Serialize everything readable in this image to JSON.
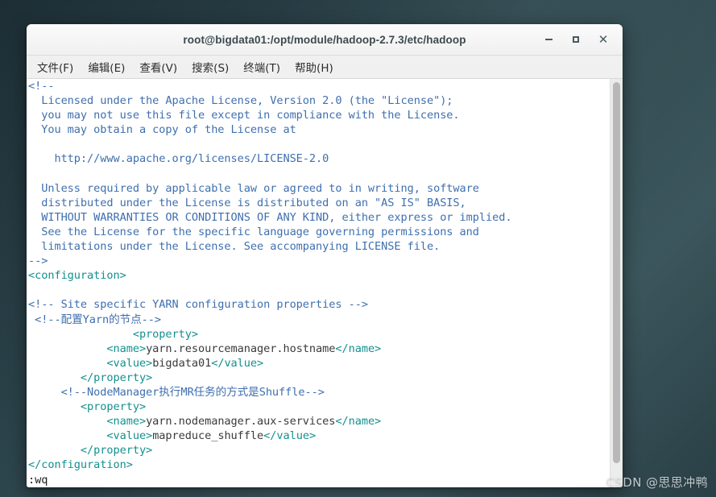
{
  "window": {
    "title": "root@bigdata01:/opt/module/hadoop-2.7.3/etc/hadoop",
    "buttons": {
      "minimize": "–",
      "maximize": "□",
      "close": "✕"
    }
  },
  "menubar": {
    "items": [
      {
        "label": "文件(F)"
      },
      {
        "label": "编辑(E)"
      },
      {
        "label": "查看(V)"
      },
      {
        "label": "搜索(S)"
      },
      {
        "label": "终端(T)"
      },
      {
        "label": "帮助(H)"
      }
    ]
  },
  "terminal": {
    "lines": [
      {
        "id": 1,
        "text": "<!--",
        "color_role": "comment"
      },
      {
        "id": 2,
        "text": "  Licensed under the Apache License, Version 2.0 (the \"License\");",
        "color_role": "comment"
      },
      {
        "id": 3,
        "text": "  you may not use this file except in compliance with the License.",
        "color_role": "comment"
      },
      {
        "id": 4,
        "text": "  You may obtain a copy of the License at",
        "color_role": "comment"
      },
      {
        "id": 5,
        "text": "",
        "color_role": "comment"
      },
      {
        "id": 6,
        "text": "    http://www.apache.org/licenses/LICENSE-2.0",
        "color_role": "comment"
      },
      {
        "id": 7,
        "text": "",
        "color_role": "comment"
      },
      {
        "id": 8,
        "text": "  Unless required by applicable law or agreed to in writing, software",
        "color_role": "comment"
      },
      {
        "id": 9,
        "text": "  distributed under the License is distributed on an \"AS IS\" BASIS,",
        "color_role": "comment"
      },
      {
        "id": 10,
        "text": "  WITHOUT WARRANTIES OR CONDITIONS OF ANY KIND, either express or implied.",
        "color_role": "comment"
      },
      {
        "id": 11,
        "text": "  See the License for the specific language governing permissions and",
        "color_role": "comment"
      },
      {
        "id": 12,
        "text": "  limitations under the License. See accompanying LICENSE file.",
        "color_role": "comment"
      },
      {
        "id": 13,
        "text": "-->",
        "color_role": "comment"
      },
      {
        "id": 14,
        "text": "<configuration>",
        "color_role": "tag"
      },
      {
        "id": 15,
        "text": "",
        "color_role": "plain"
      },
      {
        "id": 16,
        "text": "<!-- Site specific YARN configuration properties -->",
        "color_role": "comment"
      },
      {
        "id": 17,
        "text": " <!--配置Yarn的节点-->",
        "color_role": "comment"
      },
      {
        "id": 18,
        "text": "                <property>",
        "color_role": "tag"
      },
      {
        "id": 19,
        "text": "            <name>yarn.resourcemanager.hostname</name>",
        "color_role": "mixed",
        "segments": [
          {
            "t": "            ",
            "c": "plain"
          },
          {
            "t": "<name>",
            "c": "tag"
          },
          {
            "t": "yarn.resourcemanager.hostname",
            "c": "plain"
          },
          {
            "t": "</name>",
            "c": "tag"
          }
        ]
      },
      {
        "id": 20,
        "text": "            <value>bigdata01</value>",
        "color_role": "mixed",
        "segments": [
          {
            "t": "            ",
            "c": "plain"
          },
          {
            "t": "<value>",
            "c": "tag"
          },
          {
            "t": "bigdata01",
            "c": "plain"
          },
          {
            "t": "</value>",
            "c": "tag"
          }
        ]
      },
      {
        "id": 21,
        "text": "        </property>",
        "color_role": "tag"
      },
      {
        "id": 22,
        "text": "     <!--NodeManager执行MR任务的方式是Shuffle-->",
        "color_role": "comment"
      },
      {
        "id": 23,
        "text": "        <property>",
        "color_role": "tag"
      },
      {
        "id": 24,
        "text": "            <name>yarn.nodemanager.aux-services</name>",
        "color_role": "mixed",
        "segments": [
          {
            "t": "            ",
            "c": "plain"
          },
          {
            "t": "<name>",
            "c": "tag"
          },
          {
            "t": "yarn.nodemanager.aux-services",
            "c": "plain"
          },
          {
            "t": "</name>",
            "c": "tag"
          }
        ]
      },
      {
        "id": 25,
        "text": "            <value>mapreduce_shuffle</value>",
        "color_role": "mixed",
        "segments": [
          {
            "t": "            ",
            "c": "plain"
          },
          {
            "t": "<value>",
            "c": "tag"
          },
          {
            "t": "mapreduce_shuffle",
            "c": "plain"
          },
          {
            "t": "</value>",
            "c": "tag"
          }
        ]
      },
      {
        "id": 26,
        "text": "        </property>",
        "color_role": "tag"
      },
      {
        "id": 27,
        "text": "</configuration>",
        "color_role": "tag"
      },
      {
        "id": 28,
        "text": ":wq",
        "color_role": "cmd"
      }
    ],
    "command_line": ":wq"
  },
  "scrollbar": {
    "orientation": "vertical"
  },
  "watermark": {
    "text": "CSDN @思思冲鸭"
  },
  "colors": {
    "comment": "#3f6fae",
    "tag": "#13908e",
    "plain": "#3a3a3a",
    "desktop": "#2e474e",
    "titlebar": "#f0f0f0"
  }
}
